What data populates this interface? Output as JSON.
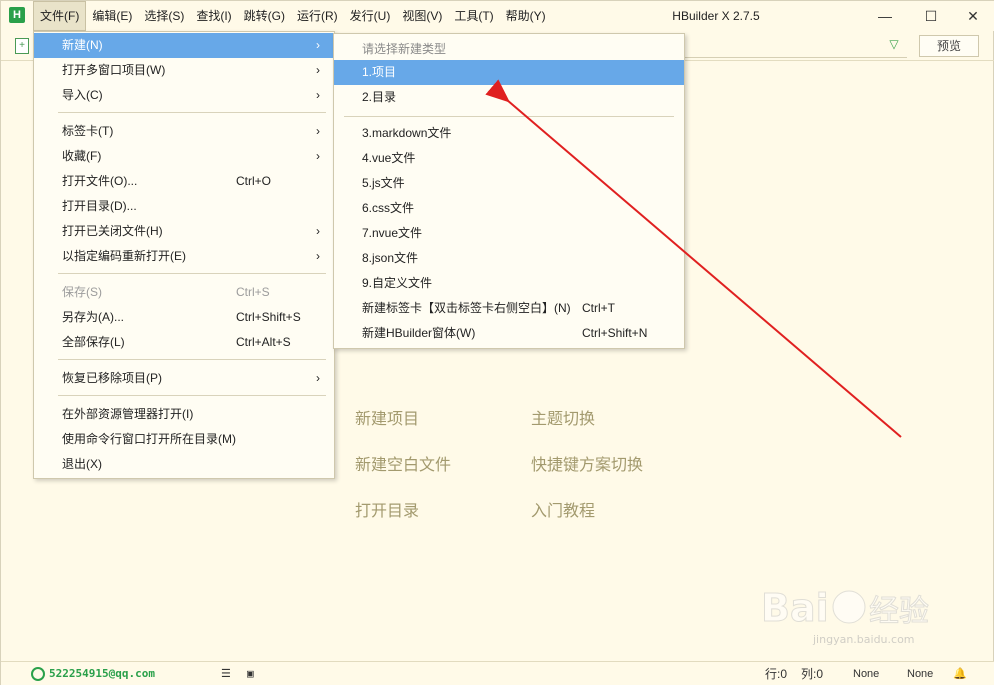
{
  "window": {
    "title": "HBuilder X 2.7.5",
    "logo": "H"
  },
  "menubar": [
    {
      "label": "文件(F)",
      "active": true
    },
    {
      "label": "编辑(E)"
    },
    {
      "label": "选择(S)"
    },
    {
      "label": "查找(I)"
    },
    {
      "label": "跳转(G)"
    },
    {
      "label": "运行(R)"
    },
    {
      "label": "发行(U)"
    },
    {
      "label": "视图(V)"
    },
    {
      "label": "工具(T)"
    },
    {
      "label": "帮助(Y)"
    }
  ],
  "window_controls": {
    "minimize": "—",
    "maximize": "☐",
    "close": "✕"
  },
  "toolbar": {
    "preview_label": "预览"
  },
  "file_menu": [
    {
      "label": "新建(N)",
      "submenu": true,
      "highlight": true
    },
    {
      "label": "打开多窗口项目(W)",
      "submenu": true
    },
    {
      "label": "导入(C)",
      "submenu": true
    },
    {
      "label": "标签卡(T)",
      "submenu": true
    },
    {
      "label": "收藏(F)",
      "submenu": true
    },
    {
      "label": "打开文件(O)...",
      "shortcut": "Ctrl+O"
    },
    {
      "label": "打开目录(D)..."
    },
    {
      "label": "打开已关闭文件(H)",
      "submenu": true
    },
    {
      "label": "以指定编码重新打开(E)",
      "submenu": true
    },
    {
      "label": "保存(S)",
      "shortcut": "Ctrl+S",
      "disabled": true
    },
    {
      "label": "另存为(A)...",
      "shortcut": "Ctrl+Shift+S"
    },
    {
      "label": "全部保存(L)",
      "shortcut": "Ctrl+Alt+S"
    },
    {
      "label": "恢复已移除项目(P)",
      "submenu": true
    },
    {
      "label": "在外部资源管理器打开(I)"
    },
    {
      "label": "使用命令行窗口打开所在目录(M)"
    },
    {
      "label": "退出(X)"
    }
  ],
  "new_submenu": {
    "header": "请选择新建类型",
    "items": [
      {
        "label": "1.项目",
        "highlight": true
      },
      {
        "label": "2.目录"
      },
      {
        "label": "3.markdown文件"
      },
      {
        "label": "4.vue文件"
      },
      {
        "label": "5.js文件"
      },
      {
        "label": "6.css文件"
      },
      {
        "label": "7.nvue文件"
      },
      {
        "label": "8.json文件"
      },
      {
        "label": "9.自定义文件"
      },
      {
        "label": "新建标签卡【双击标签卡右侧空白】(N)",
        "shortcut": "Ctrl+T"
      },
      {
        "label": "新建HBuilder窗体(W)",
        "shortcut": "Ctrl+Shift+N"
      }
    ]
  },
  "welcome": {
    "new_project": "新建项目",
    "theme_switch": "主题切换",
    "new_blank_file": "新建空白文件",
    "keymap_switch": "快捷键方案切换",
    "open_directory": "打开目录",
    "tutorial": "入门教程"
  },
  "statusbar": {
    "user": "522254915@qq.com",
    "row": "行:0",
    "col": "列:0",
    "encoding": "None",
    "syntax": "None"
  },
  "watermark": {
    "text": "Baidu经验",
    "sub": "jingyan.baidu.com"
  },
  "colors": {
    "highlight": "#67a8e8",
    "background": "#fffae8",
    "arrow": "#e02020",
    "accent": "#2aa04a"
  }
}
